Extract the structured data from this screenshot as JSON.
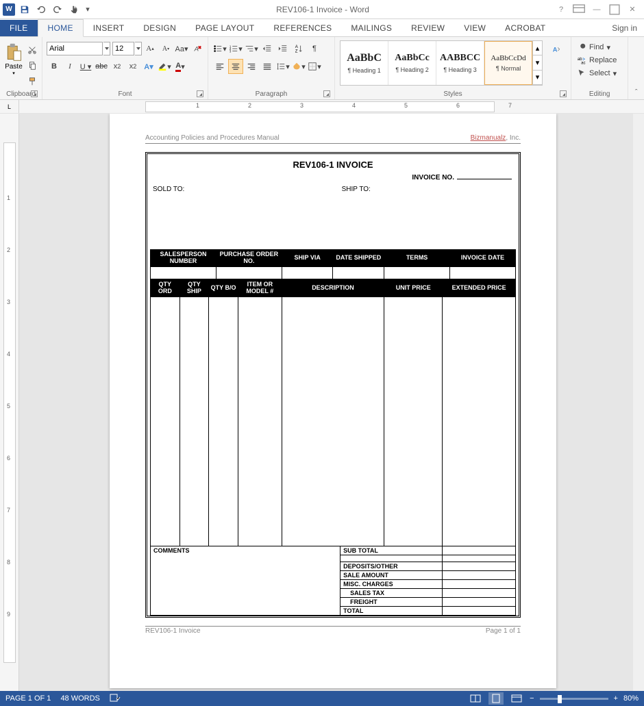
{
  "titlebar": {
    "title": "REV106-1 Invoice - Word",
    "signin": "Sign in"
  },
  "tabs": {
    "file": "FILE",
    "home": "HOME",
    "insert": "INSERT",
    "design": "DESIGN",
    "page_layout": "PAGE LAYOUT",
    "references": "REFERENCES",
    "mailings": "MAILINGS",
    "review": "REVIEW",
    "view": "VIEW",
    "acrobat": "ACROBAT"
  },
  "clipboard": {
    "paste": "Paste",
    "label": "Clipboard"
  },
  "font": {
    "name": "Arial",
    "size": "12",
    "label": "Font"
  },
  "paragraph": {
    "label": "Paragraph"
  },
  "styles": {
    "items": [
      {
        "preview": "AaBbC",
        "name": "¶ Heading 1"
      },
      {
        "preview": "AaBbCc",
        "name": "¶ Heading 2"
      },
      {
        "preview": "AABBCC",
        "name": "¶ Heading 3"
      },
      {
        "preview": "AaBbCcDd",
        "name": "¶ Normal"
      }
    ],
    "label": "Styles"
  },
  "editing": {
    "find": "Find",
    "replace": "Replace",
    "select": "Select",
    "label": "Editing"
  },
  "ruler": {
    "corner": "L"
  },
  "document": {
    "header_left": "Accounting Policies and Procedures Manual",
    "header_right_link": "Bizmanualz",
    "header_right_suffix": ", Inc.",
    "title": "REV106-1 INVOICE",
    "invoice_no_label": "INVOICE NO.",
    "sold_to": "SOLD TO:",
    "ship_to": "SHIP TO:",
    "table1_headers": [
      "SALESPERSON NUMBER",
      "PURCHASE ORDER NO.",
      "SHIP VIA",
      "DATE SHIPPED",
      "TERMS",
      "INVOICE DATE"
    ],
    "table2_headers": [
      "QTY ORD",
      "QTY SHIP",
      "QTY B/O",
      "ITEM OR MODEL #",
      "DESCRIPTION",
      "UNIT PRICE",
      "EXTENDED PRICE"
    ],
    "comments": "COMMENTS",
    "totals": [
      "SUB TOTAL",
      "DEPOSITS/OTHER",
      "SALE AMOUNT",
      "MISC. CHARGES",
      "SALES TAX",
      "FREIGHT",
      "TOTAL"
    ],
    "footer_left": "REV106-1 Invoice",
    "footer_right": "Page 1 of 1"
  },
  "status": {
    "page": "PAGE 1 OF 1",
    "words": "48 WORDS",
    "zoom": "80%"
  }
}
